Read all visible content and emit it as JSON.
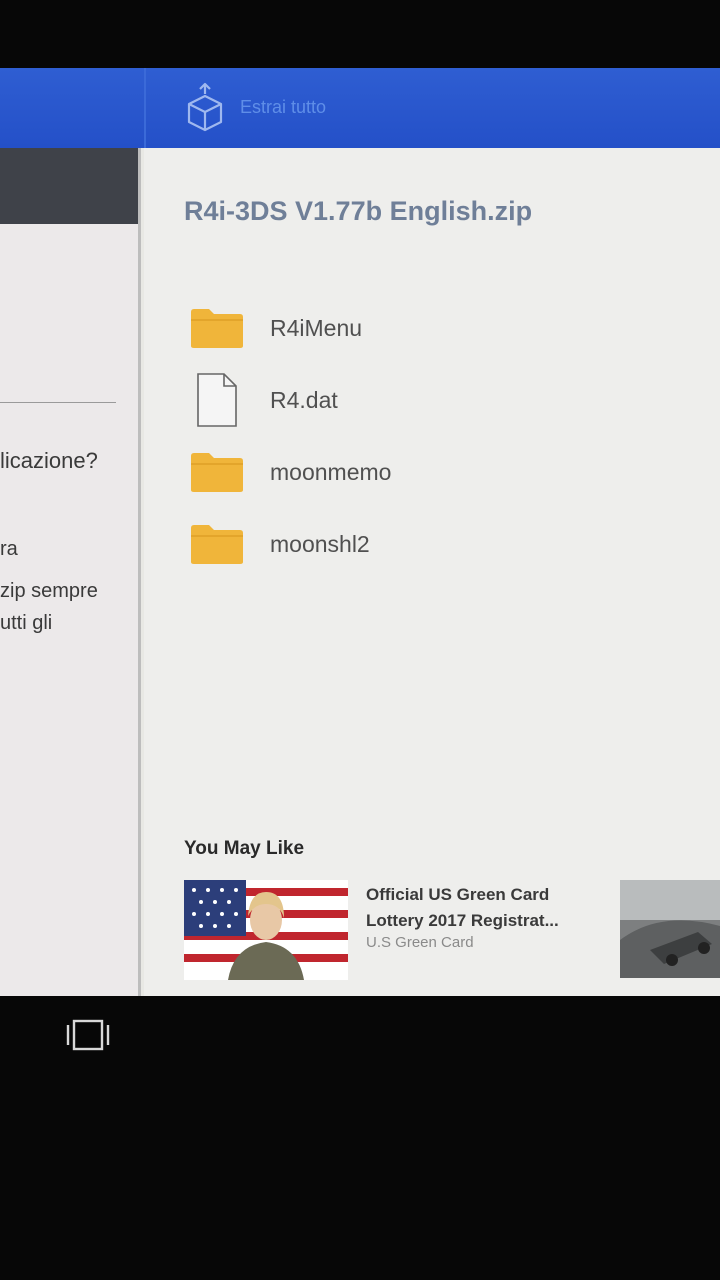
{
  "toolbar": {
    "extract_all_label": "Estrai tutto"
  },
  "left_panel": {
    "texts": [
      "licazione?",
      "ra",
      "zip sempre",
      "utti gli"
    ]
  },
  "archive": {
    "title": "R4i-3DS V1.77b English.zip",
    "items": [
      {
        "name": "R4iMenu",
        "type": "folder",
        "icon": "folder-icon"
      },
      {
        "name": "R4.dat",
        "type": "file",
        "icon": "file-icon"
      },
      {
        "name": "moonmemo",
        "type": "folder",
        "icon": "folder-icon"
      },
      {
        "name": "moonshl2",
        "type": "folder",
        "icon": "folder-icon"
      }
    ]
  },
  "recommendations": {
    "title": "You May Like",
    "ad": {
      "headline_line1": "Official US Green Card",
      "headline_line2": "Lottery 2017 Registrat...",
      "source": "U.S Green Card"
    }
  },
  "colors": {
    "toolbar_blue": "#2552c8",
    "folder_yellow": "#f0b53a",
    "title_gray_blue": "#6f7f98"
  }
}
